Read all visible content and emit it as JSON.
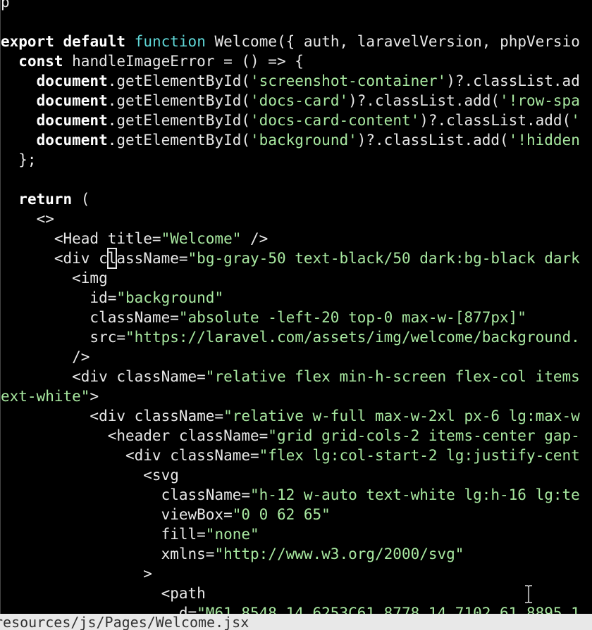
{
  "editor": {
    "lines": [
      [
        [
          "t",
          "p"
        ],
        [
          "t",
          "  "
        ],
        [
          "t",
          "                                                  "
        ]
      ],
      [
        [
          "t",
          ""
        ]
      ],
      [
        [
          "k",
          "export"
        ],
        [
          "t",
          " "
        ],
        [
          "k",
          "default"
        ],
        [
          "t",
          " "
        ],
        [
          "f",
          "function"
        ],
        [
          "t",
          " Welcome({ auth, laravelVersion, phpVersio"
        ]
      ],
      [
        [
          "t",
          "  "
        ],
        [
          "k",
          "const"
        ],
        [
          "t",
          " handleImageError = () => {"
        ]
      ],
      [
        [
          "t",
          "    "
        ],
        [
          "k",
          "document"
        ],
        [
          "t",
          ".getElementById("
        ],
        [
          "s",
          "'screenshot-container'"
        ],
        [
          "t",
          ")?.classList.ad"
        ]
      ],
      [
        [
          "t",
          "    "
        ],
        [
          "k",
          "document"
        ],
        [
          "t",
          ".getElementById("
        ],
        [
          "s",
          "'docs-card'"
        ],
        [
          "t",
          ")?.classList.add("
        ],
        [
          "s",
          "'!row-spa"
        ]
      ],
      [
        [
          "t",
          "    "
        ],
        [
          "k",
          "document"
        ],
        [
          "t",
          ".getElementById("
        ],
        [
          "s",
          "'docs-card-content'"
        ],
        [
          "t",
          ")?.classList.add("
        ],
        [
          "s",
          "'"
        ]
      ],
      [
        [
          "t",
          "    "
        ],
        [
          "k",
          "document"
        ],
        [
          "t",
          ".getElementById("
        ],
        [
          "s",
          "'background'"
        ],
        [
          "t",
          ")?.classList.add("
        ],
        [
          "s",
          "'!hidden"
        ]
      ],
      [
        [
          "t",
          "  };"
        ]
      ],
      [
        [
          "t",
          ""
        ]
      ],
      [
        [
          "t",
          "  "
        ],
        [
          "k",
          "return"
        ],
        [
          "t",
          " ("
        ]
      ],
      [
        [
          "t",
          "    <>"
        ]
      ],
      [
        [
          "t",
          "      <Head title="
        ],
        [
          "s",
          "\"Welcome\""
        ],
        [
          "t",
          " />"
        ]
      ],
      [
        [
          "t",
          "      <div c"
        ],
        [
          "cur",
          "l"
        ],
        [
          "t",
          "assName="
        ],
        [
          "s",
          "\"bg-gray-50 text-black/50 dark:bg-black dark"
        ]
      ],
      [
        [
          "t",
          "        <img"
        ]
      ],
      [
        [
          "t",
          "          id="
        ],
        [
          "s",
          "\"background\""
        ]
      ],
      [
        [
          "t",
          "          className="
        ],
        [
          "s",
          "\"absolute -left-20 top-0 max-w-[877px]\""
        ]
      ],
      [
        [
          "t",
          "          src="
        ],
        [
          "s",
          "\"https://laravel.com/assets/img/welcome/background."
        ]
      ],
      [
        [
          "t",
          "        />"
        ]
      ],
      [
        [
          "t",
          "        <div className="
        ],
        [
          "s",
          "\"relative flex min-h-screen flex-col items"
        ]
      ],
      [
        [
          "s",
          "ext-white\""
        ],
        [
          "t",
          ">"
        ]
      ],
      [
        [
          "t",
          "          <div className="
        ],
        [
          "s",
          "\"relative w-full max-w-2xl px-6 lg:max-w"
        ]
      ],
      [
        [
          "t",
          "            <header className="
        ],
        [
          "s",
          "\"grid grid-cols-2 items-center gap-"
        ]
      ],
      [
        [
          "t",
          "              <div className="
        ],
        [
          "s",
          "\"flex lg:col-start-2 lg:justify-cent"
        ]
      ],
      [
        [
          "t",
          "                <svg"
        ]
      ],
      [
        [
          "t",
          "                  className="
        ],
        [
          "s",
          "\"h-12 w-auto text-white lg:h-16 lg:te"
        ]
      ],
      [
        [
          "t",
          "                  viewBox="
        ],
        [
          "s",
          "\"0 0 62 65\""
        ]
      ],
      [
        [
          "t",
          "                  fill="
        ],
        [
          "s",
          "\"none\""
        ]
      ],
      [
        [
          "t",
          "                  xmlns="
        ],
        [
          "s",
          "\"http://www.w3.org/2000/svg\""
        ]
      ],
      [
        [
          "t",
          "                >"
        ]
      ],
      [
        [
          "t",
          "                  <path"
        ]
      ],
      [
        [
          "t",
          "                    d="
        ],
        [
          "s",
          "\"M61.8548 14.6253C61.8778 14.7102 61.8895 1"
        ]
      ]
    ]
  },
  "status_bar": {
    "file_path": "resources/js/Pages/Welcome.jsx"
  },
  "colors": {
    "background": "#000000",
    "keyword": "#ffffff",
    "function_keyword": "#5fd7d7",
    "string": "#a8e8a0",
    "text": "#e8e8e8",
    "status_bar_bg": "#e8e8e8"
  },
  "icons": {
    "mouse": "i-beam-cursor-icon"
  }
}
